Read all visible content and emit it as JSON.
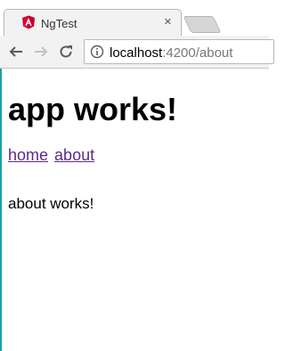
{
  "browser": {
    "tab": {
      "title": "NgTest",
      "close_glyph": "×",
      "favicon": "angular-icon"
    },
    "toolbar": {
      "back_icon": "arrow-left-icon",
      "forward_icon": "arrow-right-icon",
      "reload_icon": "reload-icon",
      "address_host": "localhost",
      "address_path": ":4200/about",
      "info_icon": "info-icon"
    }
  },
  "page": {
    "heading": "app works!",
    "nav": [
      {
        "label": "home"
      },
      {
        "label": "about"
      }
    ],
    "routed_text": "about works!"
  },
  "colors": {
    "accent_edge": "#17a2a6",
    "link_visited": "#5b2a86",
    "angular_red": "#dd0031"
  }
}
